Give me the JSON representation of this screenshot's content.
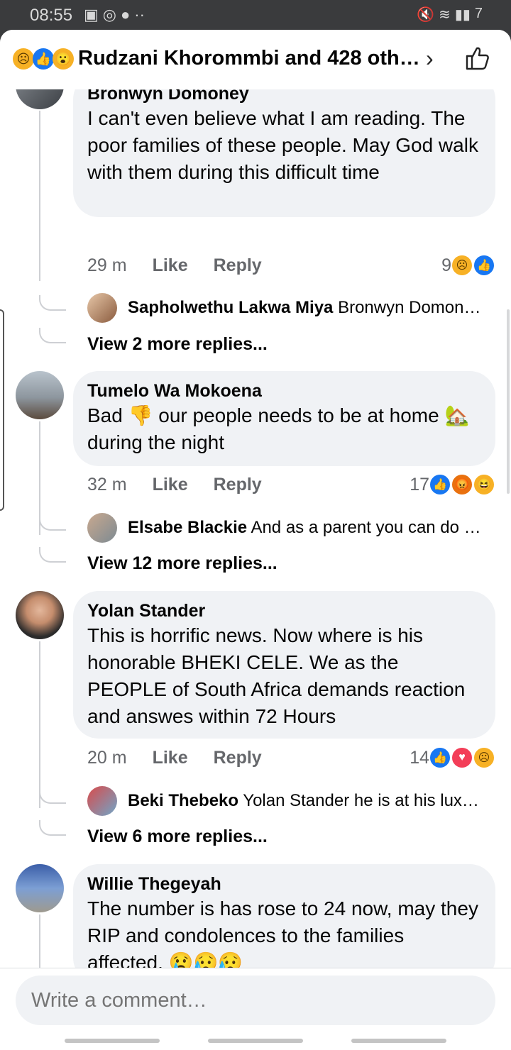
{
  "status": {
    "time": "08:55",
    "battery": "7"
  },
  "header": {
    "title": "Rudzani Khorommbi and 428 oth…"
  },
  "comments": [
    {
      "author": "Bronwyn Domoney",
      "text": "I can't even believe what I am reading. The poor families of these people. May God walk with them during this difficult time",
      "time": "29 m",
      "like": "Like",
      "reply": "Reply",
      "reaction_count": "9",
      "reply_preview": {
        "author": "Sapholwethu Lakwa Miya",
        "text": "Bronwyn Domon…"
      },
      "view_more": "View 2 more replies..."
    },
    {
      "author": "Tumelo Wa Mokoena",
      "text_a": "Bad",
      "emoji_a": "👎",
      "text_b": "our people needs to be at home",
      "emoji_b": "🏡",
      "text_c": "during the night",
      "time": "32 m",
      "like": "Like",
      "reply": "Reply",
      "reaction_count": "17",
      "reply_preview": {
        "author": "Elsabe Blackie",
        "text": "And as a parent you can do …"
      },
      "view_more": "View 12 more replies..."
    },
    {
      "author": "Yolan Stander",
      "text": "This is horrific news. Now where is his honorable BHEKI CELE. We as the PEOPLE of South Africa demands reaction and answes within 72 Hours",
      "time": "20 m",
      "like": "Like",
      "reply": "Reply",
      "reaction_count": "14",
      "reply_preview": {
        "author": "Beki Thebeko",
        "text": "Yolan Stander he is at his lux…"
      },
      "view_more": "View 6 more replies..."
    },
    {
      "author": "Willie Thegeyah",
      "text": "The number is has rose to 24 now, may they RIP and condolences to the families affected.",
      "emojis": "😢😥😥"
    }
  ],
  "composer": {
    "placeholder": "Write a comment…"
  }
}
